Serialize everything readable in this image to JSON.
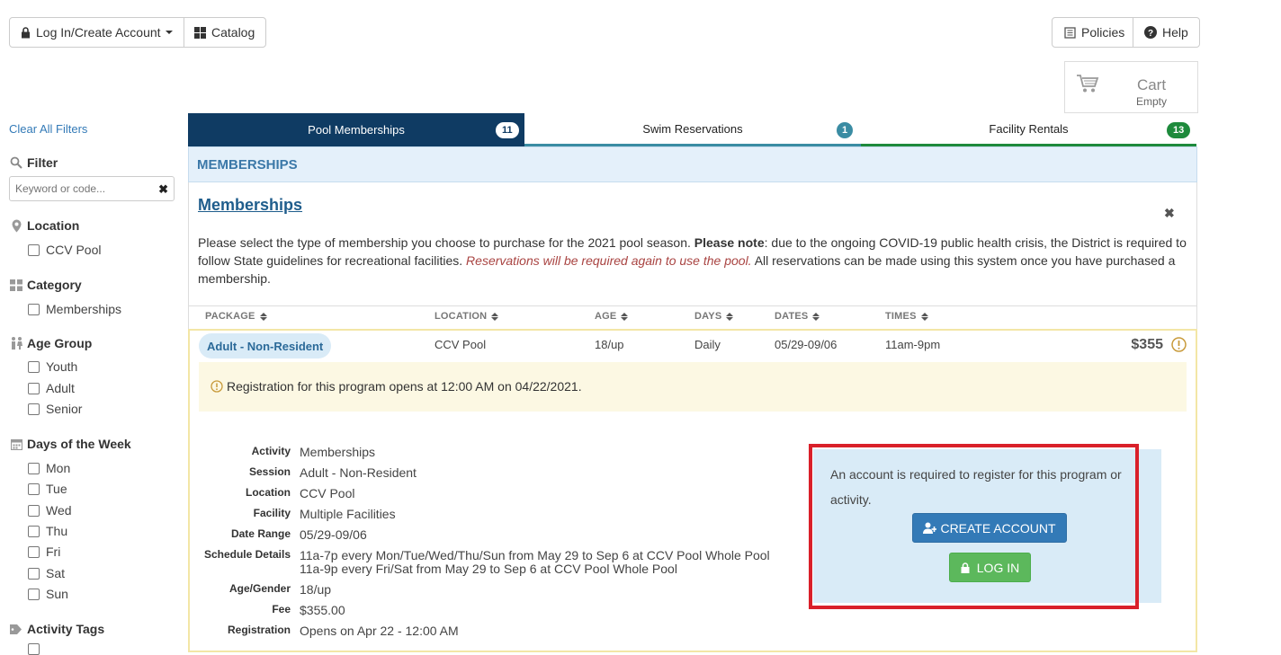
{
  "toolbar": {
    "login_label": "Log In/Create Account",
    "catalog_label": "Catalog",
    "policies_label": "Policies",
    "help_label": "Help"
  },
  "cart": {
    "title": "Cart",
    "status": "Empty"
  },
  "sidebar": {
    "clear_filters": "Clear All Filters",
    "filter_label": "Filter",
    "search_placeholder": "Keyword or code...",
    "location_label": "Location",
    "location_items": [
      "CCV Pool"
    ],
    "category_label": "Category",
    "category_items": [
      "Memberships"
    ],
    "age_group_label": "Age Group",
    "age_group_items": [
      "Youth",
      "Adult",
      "Senior"
    ],
    "days_label": "Days of the Week",
    "days_items": [
      "Mon",
      "Tue",
      "Wed",
      "Thu",
      "Fri",
      "Sat",
      "Sun"
    ],
    "activity_tags_label": "Activity Tags"
  },
  "tabs": [
    {
      "label": "Pool Memberships",
      "count": "11",
      "color": "#0f3b63"
    },
    {
      "label": "Swim Reservations",
      "count": "1",
      "color": "#3a8ca3"
    },
    {
      "label": "Facility Rentals",
      "count": "13",
      "color": "#1e8a3c"
    }
  ],
  "section": {
    "header": "MEMBERSHIPS",
    "title": "Memberships",
    "desc_1": "Please select the type of membership you choose to purchase for the 2021 pool season. ",
    "desc_bold": "Please note",
    "desc_2": ": due to the ongoing COVID-19 public health crisis, the District is required to follow State guidelines for recreational facilities. ",
    "desc_italic": "Reservations will be required again to use the pool.",
    "desc_3": " All reservations can be made using this system once you have purchased a membership."
  },
  "table": {
    "headers": [
      "PACKAGE",
      "LOCATION",
      "AGE",
      "DAYS",
      "DATES",
      "TIMES"
    ],
    "row": {
      "package": "Adult - Non-Resident",
      "location": "CCV Pool",
      "age": "18/up",
      "days": "Daily",
      "dates": "05/29-09/06",
      "times": "11am-9pm",
      "price": "$355"
    }
  },
  "notice": "Registration for this program opens at 12:00 AM on 04/22/2021.",
  "details": [
    {
      "label": "Activity",
      "value": "Memberships"
    },
    {
      "label": "Session",
      "value": "Adult - Non-Resident"
    },
    {
      "label": "Location",
      "value": "CCV Pool"
    },
    {
      "label": "Facility",
      "value": "Multiple Facilities"
    },
    {
      "label": "Date Range",
      "value": "05/29-09/06"
    },
    {
      "label": "Schedule Details",
      "value": "11a-7p every Mon/Tue/Wed/Thu/Sun from May 29 to Sep 6 at CCV Pool Whole Pool",
      "value2": "11a-9p every Fri/Sat from May 29 to Sep 6 at CCV Pool Whole Pool"
    },
    {
      "label": "Age/Gender",
      "value": "18/up"
    },
    {
      "label": "Fee",
      "value": "$355.00"
    },
    {
      "label": "Registration",
      "value": "Opens on Apr 22 - 12:00 AM"
    }
  ],
  "account_box": {
    "message": "An account is required to register for this program or activity.",
    "create_label": "CREATE ACCOUNT",
    "login_label": "LOG IN"
  },
  "colors": {
    "accent_blue": "#337ab7",
    "success_green": "#5cb85c",
    "highlight_red": "#d9202a",
    "notice_bg": "#fcf8e3",
    "italic_red": "#a94442"
  }
}
